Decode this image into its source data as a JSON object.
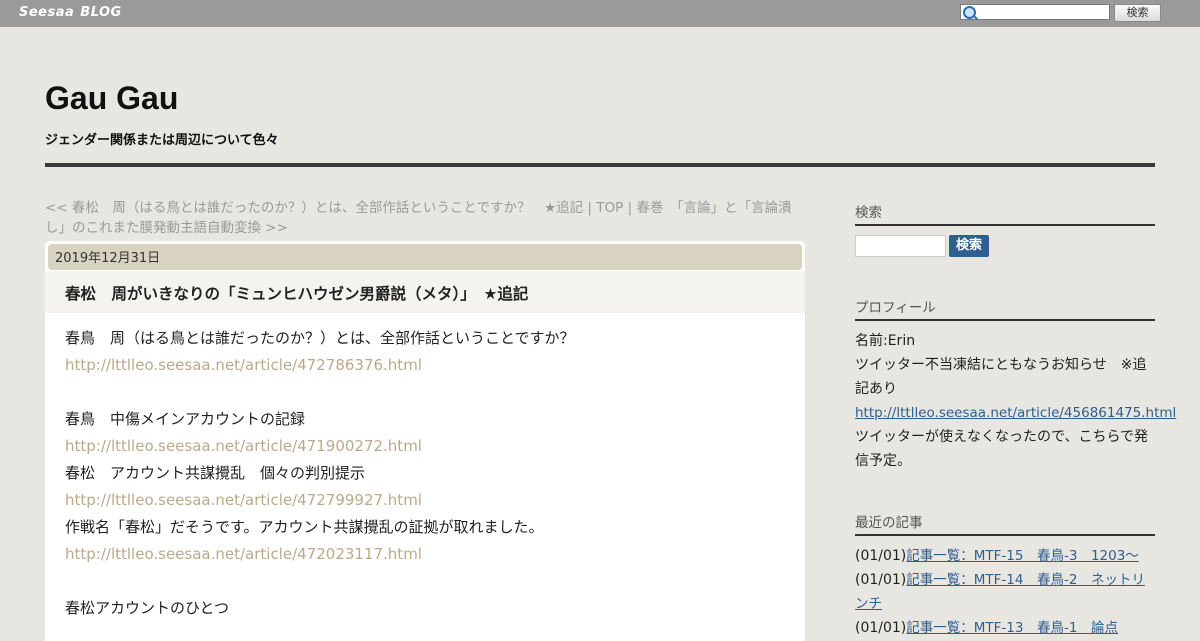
{
  "topbar": {
    "brand": "Seesaa",
    "brand_blog": "BLOG",
    "search_button": "検索"
  },
  "header": {
    "title": "Gau Gau",
    "description": "ジェンダー関係または周辺について色々"
  },
  "pager": {
    "prev": "<< 春松　周（はる鳥とは誰だったのか？）とは、全部作話ということですか？　★追記",
    "sep1": " | ",
    "top": "TOP",
    "sep2": " | ",
    "next": "春巻　「言論」と「言論潰し」のこれまた膜発動主語自動変換 >>"
  },
  "article": {
    "date": "2019年12月31日",
    "title": "春松　周がいきなりの「ミュンヒハウゼン男爵説（メタ）」　★追記",
    "lines": [
      {
        "text": "春鳥　周（はる鳥とは誰だったのか？）とは、全部作話ということですか？",
        "link": false
      },
      {
        "text": "http://lttlleo.seesaa.net/article/472786376.html",
        "link": true
      },
      {
        "text": "",
        "link": false
      },
      {
        "text": "春鳥　中傷メインアカウントの記録",
        "link": false
      },
      {
        "text": "http://lttlleo.seesaa.net/article/471900272.html",
        "link": true
      },
      {
        "text": "春松　アカウント共謀攪乱　個々の判別提示",
        "link": false
      },
      {
        "text": "http://lttlleo.seesaa.net/article/472799927.html",
        "link": true
      },
      {
        "text": "作戦名「春松」だそうです。アカウント共謀攪乱の証拠が取れました。",
        "link": false
      },
      {
        "text": "http://lttlleo.seesaa.net/article/472023117.html",
        "link": true
      },
      {
        "text": "",
        "link": false
      },
      {
        "text": "春松アカウントのひとつ",
        "link": false
      }
    ]
  },
  "sidebar": {
    "search_heading": "検索",
    "search_button": "検索",
    "profile_heading": "プロフィール",
    "profile_name": "名前:Erin",
    "profile_line1": "ツイッター不当凍結にともなうお知らせ　※追",
    "profile_line2": "記あり",
    "profile_link": "http://lttlleo.seesaa.net/article/456861475.html",
    "profile_line3": "ツイッターが使えなくなったので、こちらで発",
    "profile_line4": "信予定。",
    "recent_heading": "最近の記事",
    "recent": [
      {
        "date": "(01/01)",
        "title": "記事一覧：MTF-15　春鳥-3　1203～"
      },
      {
        "date": "(01/01)",
        "title": "記事一覧：MTF-14　春鳥-2　ネットリ"
      },
      {
        "date": "",
        "title": "ンチ"
      },
      {
        "date": "(01/01)",
        "title": "記事一覧：MTF-13　春鳥-1　論点"
      }
    ]
  }
}
